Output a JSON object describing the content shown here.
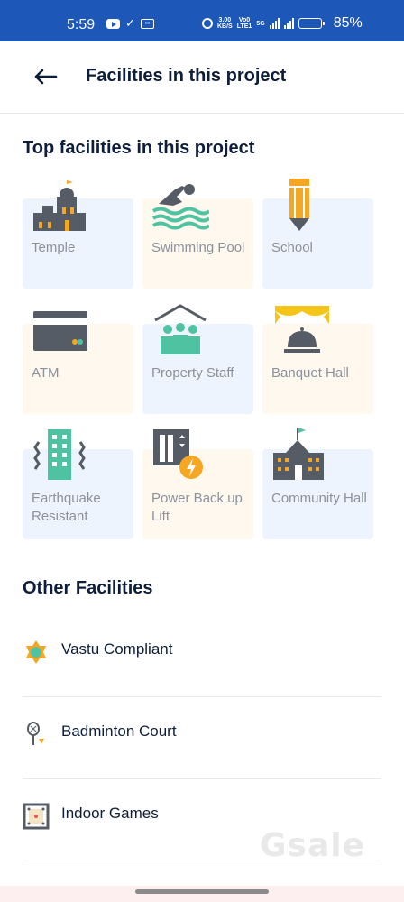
{
  "status_bar": {
    "time": "5:59",
    "speed_top": "3.00",
    "speed_bottom": "KB/S",
    "volte_top": "Vo0",
    "volte_bottom": "LTE1",
    "net_type": "5G",
    "battery": "85%",
    "battery_level": 0.85,
    "bg_color": "#1d57b8"
  },
  "header": {
    "back_icon": "arrow-left-icon",
    "title": "Facilities in this project"
  },
  "top_facilities": {
    "title": "Top facilities in this project",
    "items": [
      {
        "label": "Temple",
        "icon": "temple-icon",
        "tint": "blue"
      },
      {
        "label": "Swimming Pool",
        "icon": "swimming-pool-icon",
        "tint": "cream"
      },
      {
        "label": "School",
        "icon": "school-icon",
        "tint": "blue"
      },
      {
        "label": "ATM",
        "icon": "atm-icon",
        "tint": "cream"
      },
      {
        "label": "Property Staff",
        "icon": "property-staff-icon",
        "tint": "blue"
      },
      {
        "label": "Banquet Hall",
        "icon": "banquet-hall-icon",
        "tint": "cream"
      },
      {
        "label": "Earthquake Resistant",
        "icon": "earthquake-resistant-icon",
        "tint": "blue"
      },
      {
        "label": "Power Back up Lift",
        "icon": "power-backup-lift-icon",
        "tint": "cream"
      },
      {
        "label": "Community Hall",
        "icon": "community-hall-icon",
        "tint": "blue"
      }
    ]
  },
  "other_facilities": {
    "title": "Other Facilities",
    "items": [
      {
        "label": "Vastu Compliant",
        "icon": "vastu-icon"
      },
      {
        "label": "Badminton Court",
        "icon": "badminton-icon"
      },
      {
        "label": "Indoor Games",
        "icon": "indoor-games-icon"
      }
    ]
  },
  "watermark": "Gsale",
  "colors": {
    "primary_text": "#0e1e3a",
    "secondary_text": "#8c919c",
    "accent_orange": "#f5a623",
    "accent_teal": "#4fc3a1",
    "icon_gray": "#565c66",
    "tile_blue": "#eef4fe",
    "tile_cream": "#fef8ef"
  }
}
